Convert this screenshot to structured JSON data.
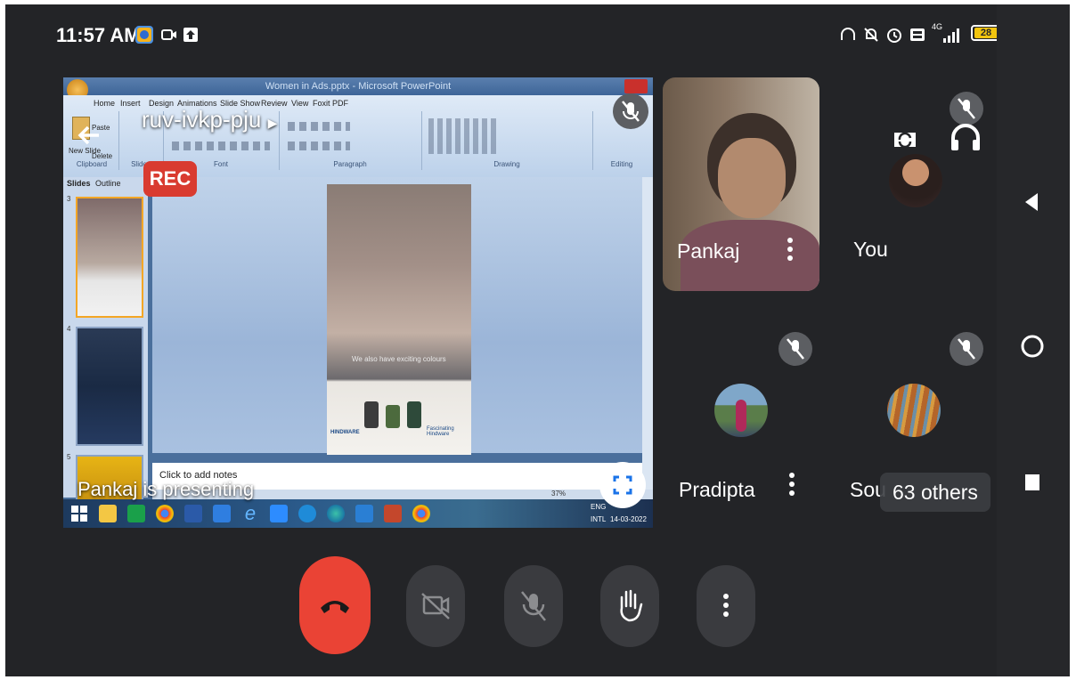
{
  "status_bar": {
    "time": "11:57 AM",
    "network_label": "4G",
    "battery": "28"
  },
  "presentation": {
    "meeting_code": "ruv-ivkp-pju",
    "rec_label": "REC",
    "presenting_text": "Pankaj is presenting",
    "ppt": {
      "window_title": "Women in Ads.pptx - Microsoft PowerPoint",
      "ribbon_tabs": [
        "Home",
        "Insert",
        "Design",
        "Animations",
        "Slide Show",
        "Review",
        "View",
        "Foxit PDF"
      ],
      "groups": [
        "Clipboard",
        "Slides",
        "Font",
        "Paragraph",
        "Drawing",
        "Editing"
      ],
      "clipboard_items": [
        "Paste",
        "New Slide",
        "Delete"
      ],
      "pane_tabs": [
        "Slides",
        "Outline"
      ],
      "slide_numbers": [
        "3",
        "4",
        "5"
      ],
      "slide_caption": "We also have exciting colours",
      "ad_brand": "HINDWARE",
      "ad_tagline": "Fascinating Hindware",
      "notes_placeholder": "Click to add notes",
      "zoom": "37%",
      "language": "ENG",
      "locale": "INTL",
      "date": "14-03-2022"
    }
  },
  "participants": [
    {
      "name": "Pankaj"
    },
    {
      "name": "You"
    },
    {
      "name": "Pradipta"
    },
    {
      "name": "Sou"
    }
  ],
  "others_label": "63 others",
  "colors": {
    "background": "#232427",
    "end_call": "#ea4335",
    "control_button": "#3a3b3f",
    "rec": "#d93b30"
  }
}
